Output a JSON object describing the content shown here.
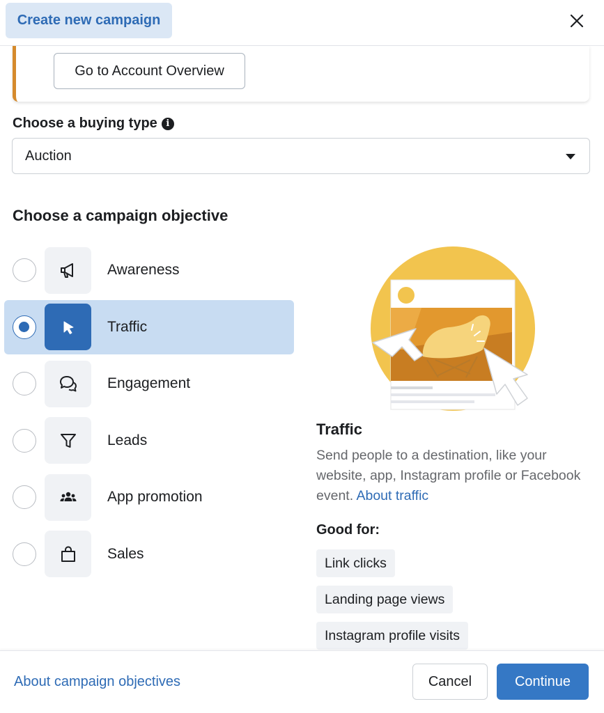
{
  "header": {
    "tab_title": "Create new campaign",
    "close_icon": "close-icon"
  },
  "notice": {
    "button_label": "Go to Account Overview"
  },
  "buying_type": {
    "label": "Choose a buying type",
    "selected": "Auction"
  },
  "objective_section": {
    "title": "Choose a campaign objective"
  },
  "objectives": [
    {
      "label": "Awareness",
      "icon": "megaphone-icon",
      "selected": false
    },
    {
      "label": "Traffic",
      "icon": "cursor-icon",
      "selected": true
    },
    {
      "label": "Engagement",
      "icon": "chat-bubbles-icon",
      "selected": false
    },
    {
      "label": "Leads",
      "icon": "funnel-icon",
      "selected": false
    },
    {
      "label": "App promotion",
      "icon": "people-icon",
      "selected": false
    },
    {
      "label": "Sales",
      "icon": "shopping-bag-icon",
      "selected": false
    }
  ],
  "detail": {
    "title": "Traffic",
    "description": "Send people to a destination, like your website, app, Instagram profile or Facebook event.",
    "link": "About traffic",
    "good_for_label": "Good for:",
    "chips": [
      "Link clicks",
      "Landing page views",
      "Instagram profile visits"
    ]
  },
  "footer": {
    "link": "About campaign objectives",
    "cancel": "Cancel",
    "continue": "Continue"
  },
  "colors": {
    "accent": "#2e6bb5",
    "selected_bg": "#c8dcf2",
    "notice_border": "#d58a2c",
    "illustration_yellow": "#f2c44e"
  }
}
